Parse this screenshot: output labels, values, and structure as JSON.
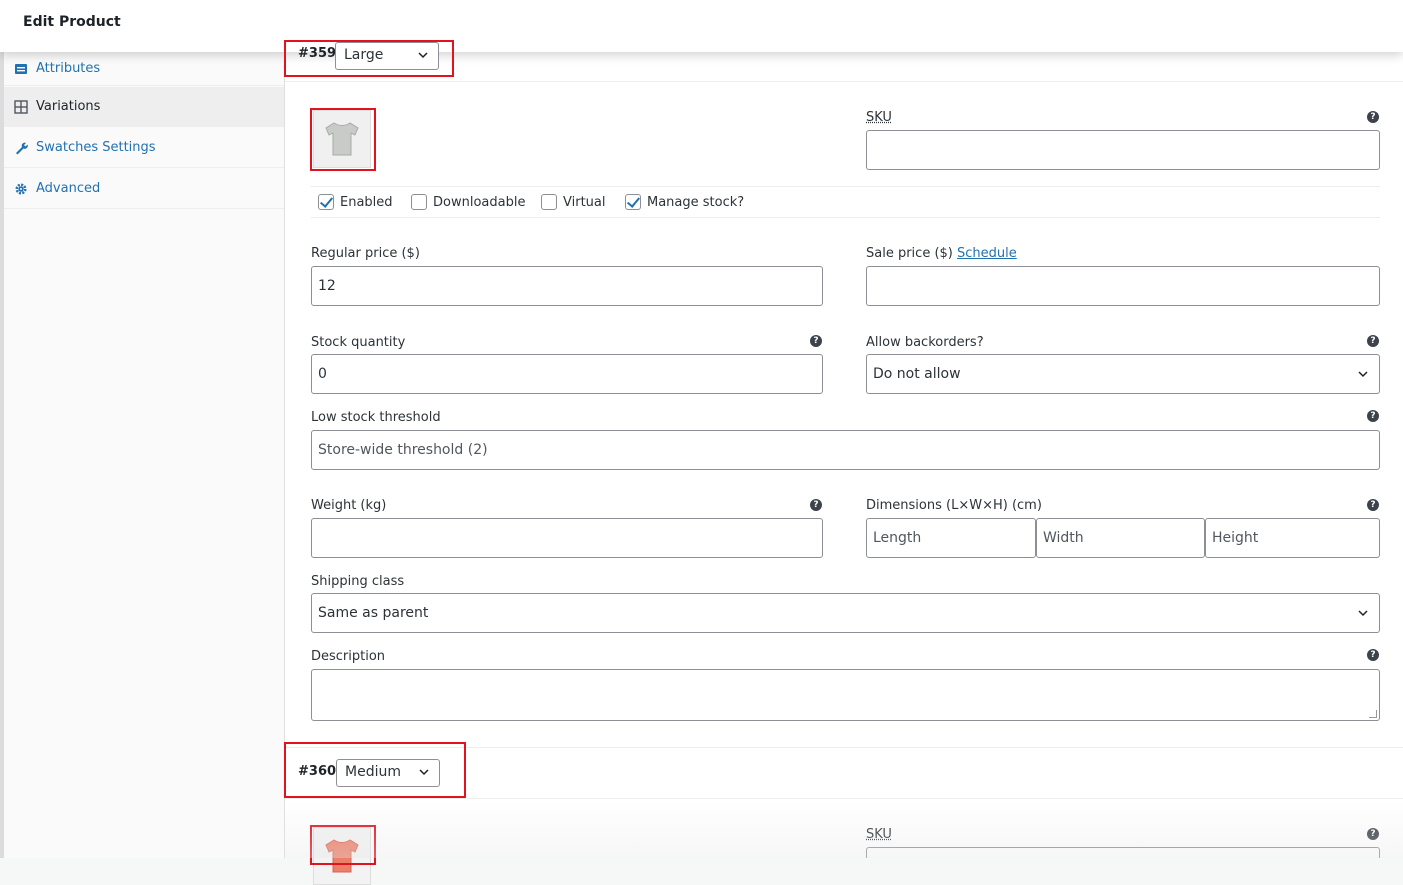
{
  "topbar": {
    "title": "Edit Product"
  },
  "sidebar": {
    "items": [
      {
        "label": "Attributes",
        "icon": "list-icon"
      },
      {
        "label": "Variations",
        "icon": "grid-icon"
      },
      {
        "label": "Swatches Settings",
        "icon": "wrench-icon"
      },
      {
        "label": "Advanced",
        "icon": "gear-icon"
      }
    ]
  },
  "variation1": {
    "id": "#359",
    "option": "Large",
    "sku_label": "SKU",
    "sku_value": "",
    "checkboxes": [
      {
        "label": "Enabled",
        "checked": true
      },
      {
        "label": "Downloadable",
        "checked": false
      },
      {
        "label": "Virtual",
        "checked": false
      },
      {
        "label": "Manage stock?",
        "checked": true
      }
    ],
    "regular_price_label": "Regular price ($)",
    "regular_price": "12",
    "sale_price_label": "Sale price ($)",
    "schedule_link": "Schedule",
    "sale_price": "",
    "stock_qty_label": "Stock quantity",
    "stock_qty": "0",
    "backorders_label": "Allow backorders?",
    "backorders": "Do not allow",
    "low_stock_label": "Low stock threshold",
    "low_stock_placeholder": "Store-wide threshold (2)",
    "weight_label": "Weight (kg)",
    "weight": "",
    "dimensions_label": "Dimensions (L×W×H) (cm)",
    "length_placeholder": "Length",
    "width_placeholder": "Width",
    "height_placeholder": "Height",
    "shipping_label": "Shipping class",
    "shipping": "Same as parent",
    "description_label": "Description",
    "description": ""
  },
  "variation2": {
    "id": "#360",
    "option": "Medium",
    "sku_label": "SKU"
  },
  "colors": {
    "accent": "#2271b1",
    "highlight": "#e1131f"
  }
}
